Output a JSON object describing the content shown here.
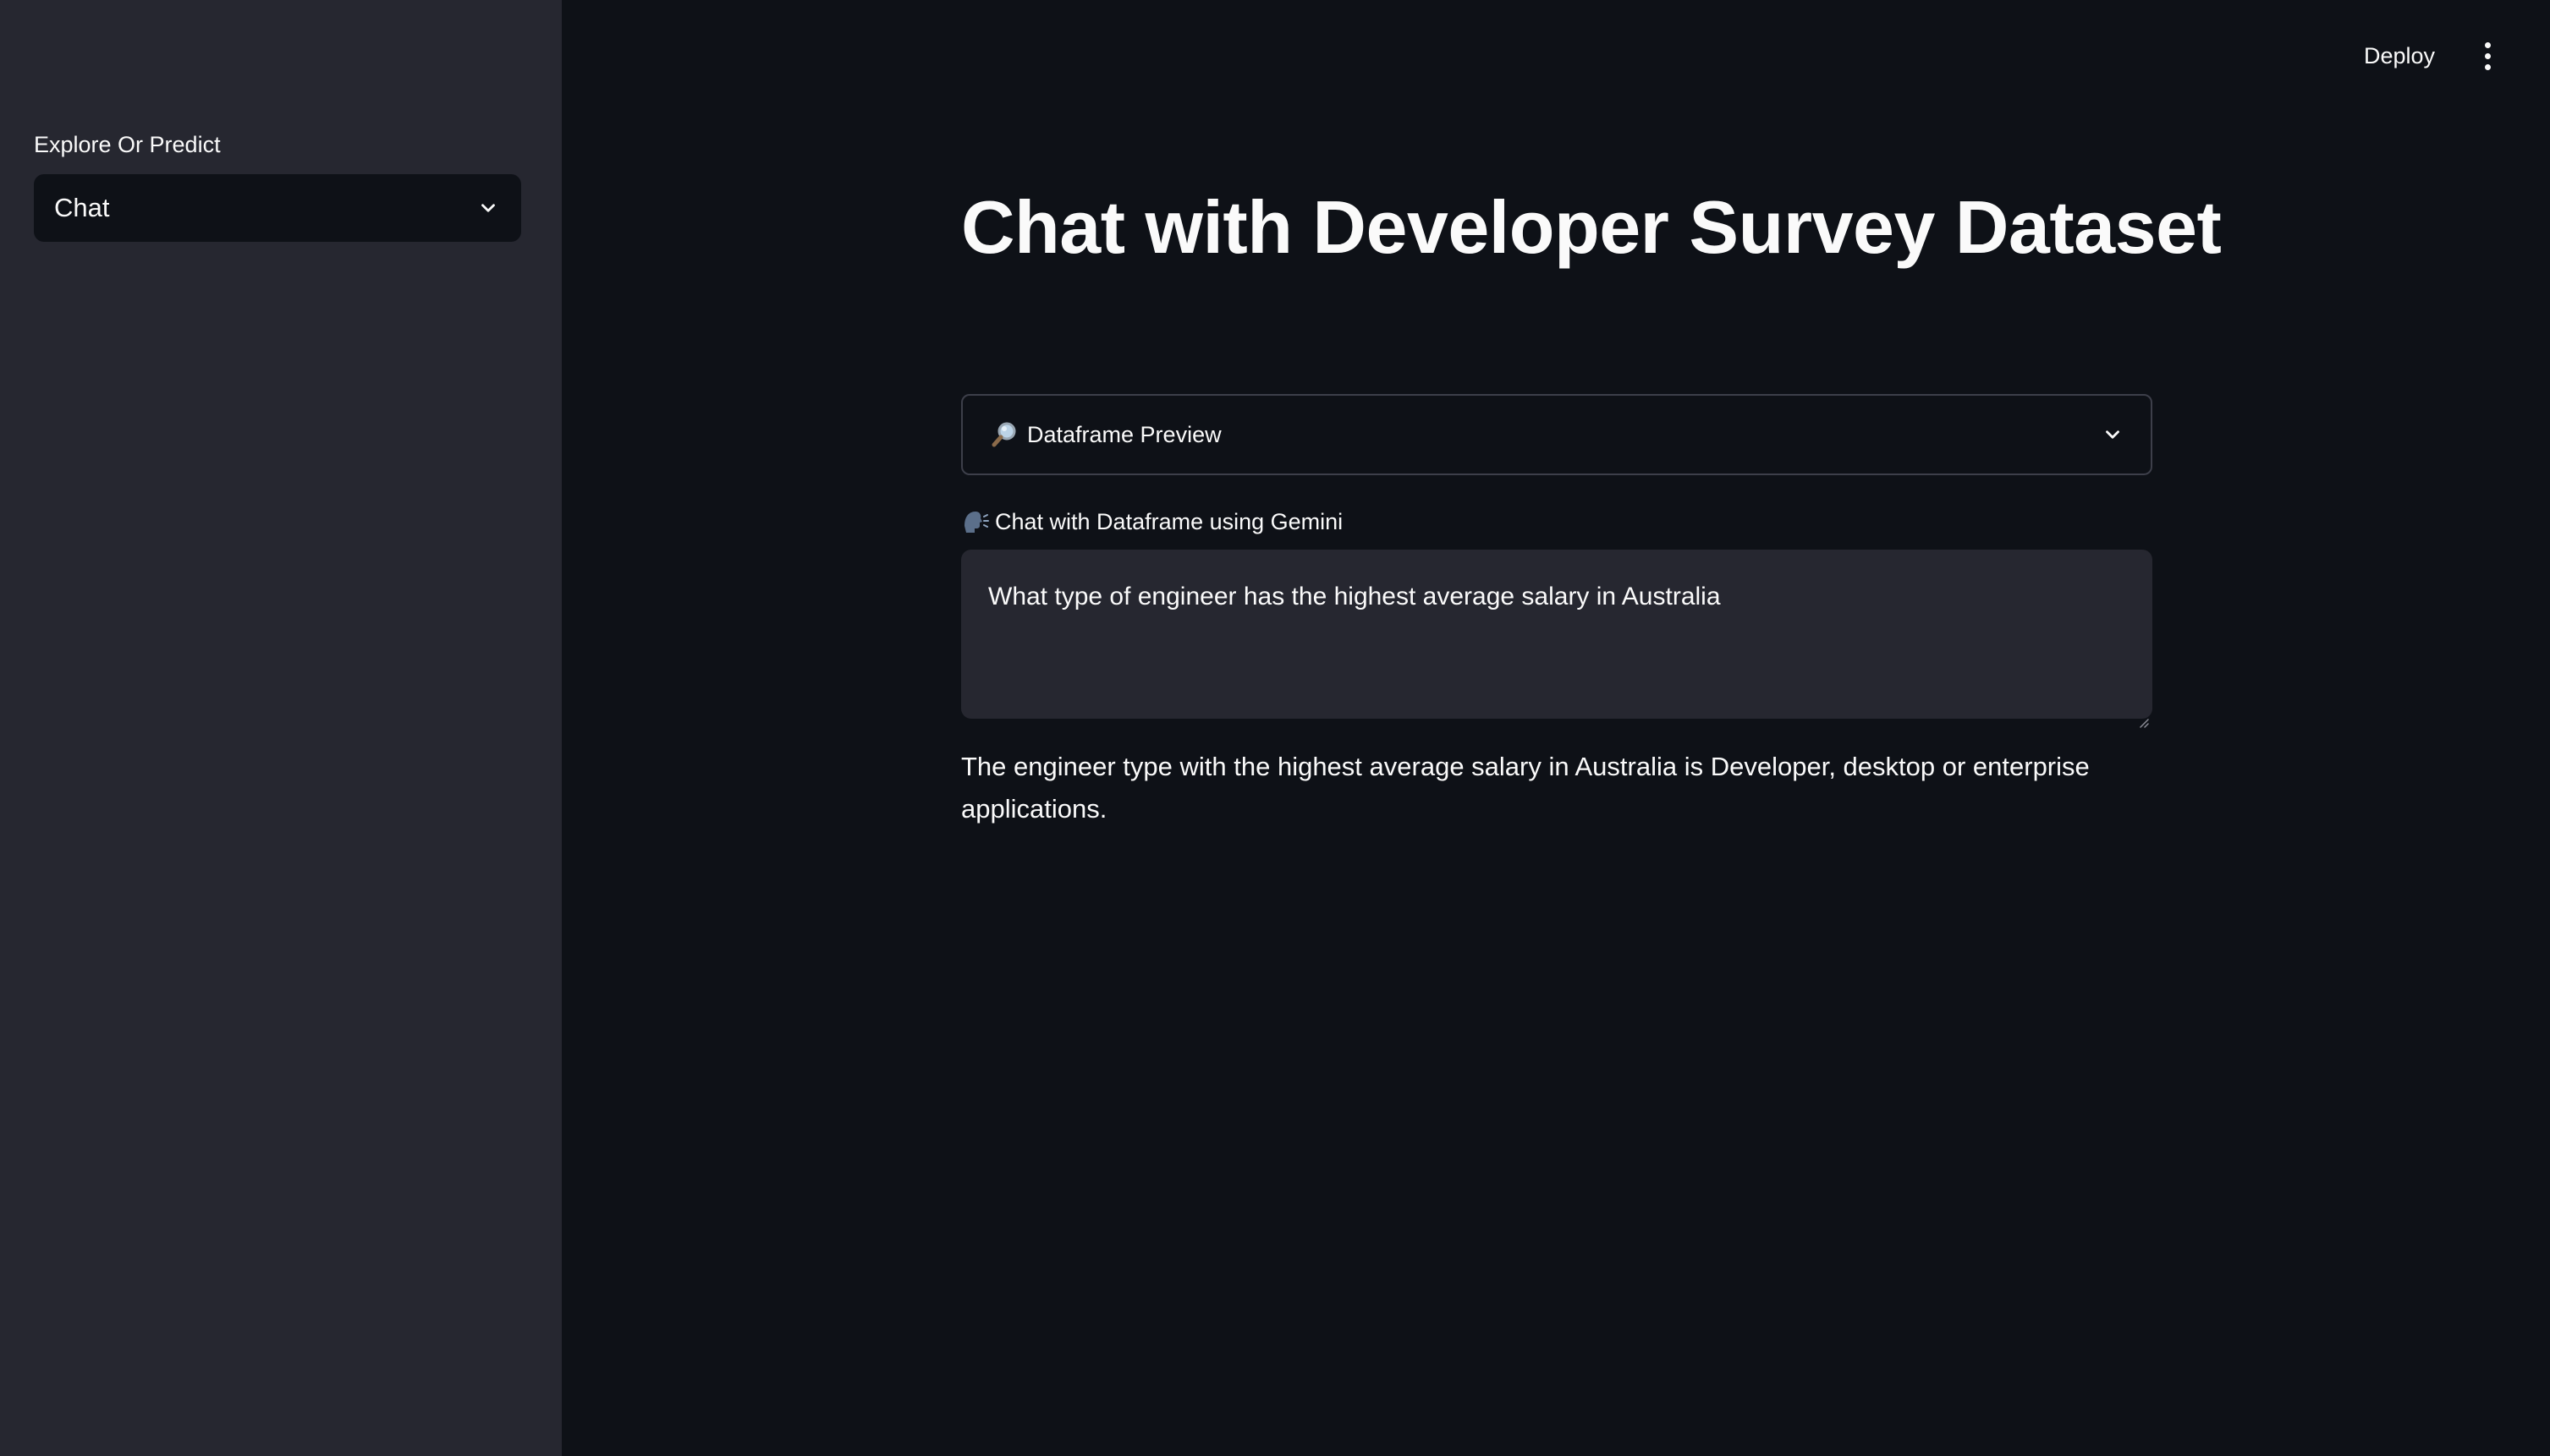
{
  "sidebar": {
    "select_label": "Explore Or Predict",
    "select_value": "Chat"
  },
  "header": {
    "deploy_label": "Deploy",
    "menu_icon": "vertical-ellipsis-icon"
  },
  "main": {
    "title": "Chat with Developer Survey Dataset",
    "expander": {
      "icon": "magnifier-emoji",
      "label": "Dataframe Preview"
    },
    "chat": {
      "icon": "speaking-head-emoji",
      "label": "Chat with Dataframe using Gemini",
      "input_value": "What type of engineer has the highest average salary in Australia"
    },
    "answer": "The engineer type with the highest average salary in Australia is Developer, desktop or enterprise applications."
  },
  "colors": {
    "background": "#0e1117",
    "sidebar": "#262730",
    "text": "#fafafa",
    "border": "#3d3f4a"
  }
}
